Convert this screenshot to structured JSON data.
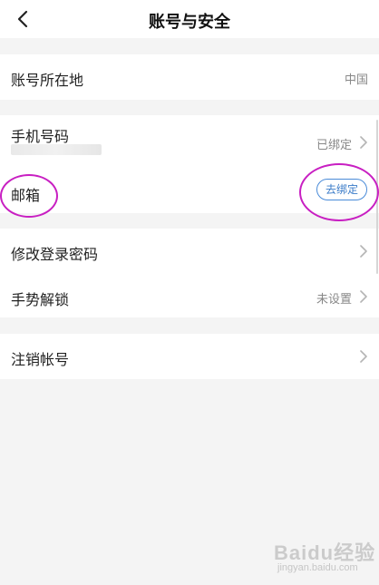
{
  "header": {
    "title": "账号与安全"
  },
  "rows": {
    "location": {
      "label": "账号所在地",
      "value": "中国"
    },
    "phone": {
      "label": "手机号码",
      "value": "已绑定"
    },
    "email": {
      "label": "邮箱",
      "button": "去绑定"
    },
    "password": {
      "label": "修改登录密码"
    },
    "gesture": {
      "label": "手势解锁",
      "value": "未设置"
    },
    "deactivate": {
      "label": "注销帐号"
    }
  },
  "watermark": {
    "main": "Baidu经验",
    "sub": "jingyan.baidu.com"
  },
  "colors": {
    "accent": "#3a7bc8",
    "annotation": "#c81fc2",
    "background": "#f4f4f4"
  },
  "icons": [
    "back-arrow-icon",
    "chevron-right-icon"
  ]
}
